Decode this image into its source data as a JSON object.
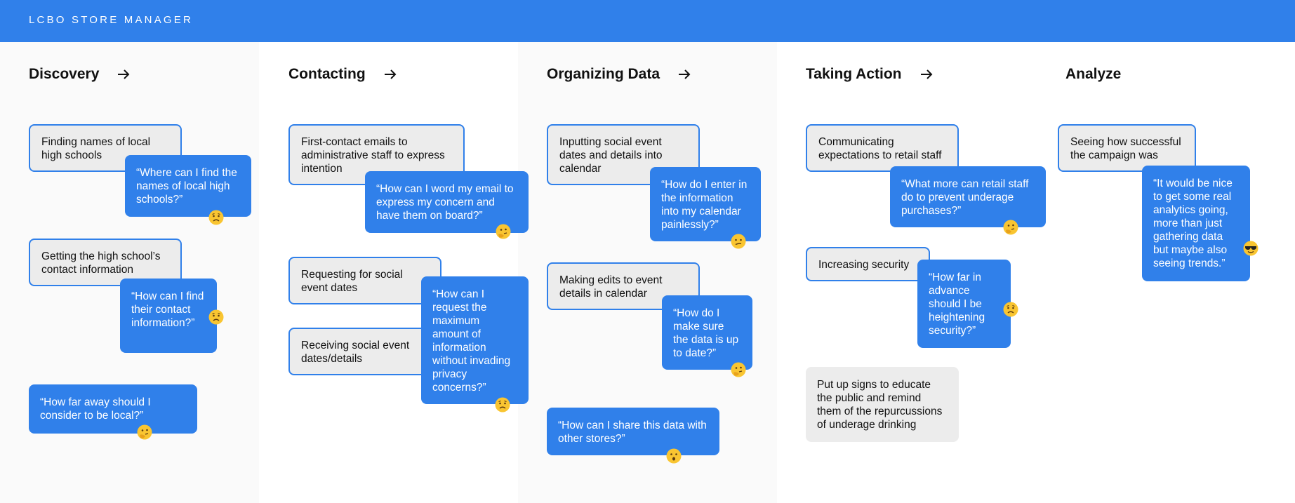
{
  "app": {
    "title": "LCBO STORE MANAGER",
    "accent": "#3080ea"
  },
  "columns": [
    {
      "heading": "Discovery",
      "arrow": true,
      "cards": [
        {
          "type": "task",
          "text": "Finding names of local high schools"
        },
        {
          "type": "quote",
          "text": "“Where can I find the names of local high schools?”",
          "emoji": "worried-face"
        },
        {
          "type": "task",
          "text": "Getting the high school’s contact information"
        },
        {
          "type": "quote",
          "text": "“How can I find their contact information?”",
          "emoji": "worried-face"
        },
        {
          "type": "quote",
          "text": "“How far away should I consider to be local?”",
          "emoji": "thinking-face"
        }
      ]
    },
    {
      "heading": "Contacting",
      "arrow": true,
      "cards": [
        {
          "type": "task",
          "text": "First-contact emails to administrative staff to express intention"
        },
        {
          "type": "quote",
          "text": "“How can I word my email to express my concern and have them on board?”",
          "emoji": "thinking-face"
        },
        {
          "type": "task",
          "text": "Requesting for social event dates"
        },
        {
          "type": "task",
          "text": "Receiving social event dates/details"
        },
        {
          "type": "quote",
          "text": "“How can I request the maximum amount of information without invading privacy concerns?”",
          "emoji": "worried-face"
        }
      ]
    },
    {
      "heading": "Organizing Data",
      "arrow": true,
      "cards": [
        {
          "type": "task",
          "text": "Inputting social event dates and details into calendar"
        },
        {
          "type": "quote",
          "text": "“How do I enter in the information into my calendar painlessly?”",
          "emoji": "confused-face"
        },
        {
          "type": "task",
          "text": "Making edits to event details in calendar"
        },
        {
          "type": "quote",
          "text": "“How do I make sure the data is up to date?”",
          "emoji": "thinking-face"
        },
        {
          "type": "quote",
          "text": "“How can I share this data with other stores?”",
          "emoji": "hushed-face"
        }
      ]
    },
    {
      "heading": "Taking Action",
      "arrow": true,
      "cards": [
        {
          "type": "task",
          "text": "Communicating expectations to retail staff"
        },
        {
          "type": "quote",
          "text": "“What more can retail staff do to prevent underage purchases?”",
          "emoji": "thinking-face"
        },
        {
          "type": "task",
          "text": "Increasing security"
        },
        {
          "type": "quote",
          "text": "“How far in advance should I be heightening security?”",
          "emoji": "worried-face"
        },
        {
          "type": "idea",
          "text": "Put up signs to educate the public and remind them of the repurcussions of underage drinking"
        }
      ]
    },
    {
      "heading": "Analyze",
      "arrow": false,
      "cards": [
        {
          "type": "task",
          "text": "Seeing how successful the campaign was"
        },
        {
          "type": "quote",
          "text": "“It would be nice to get some real analytics going, more than just gathering data but maybe also seeing trends.”",
          "emoji": "smiling-face-with-sunglasses"
        }
      ]
    }
  ]
}
